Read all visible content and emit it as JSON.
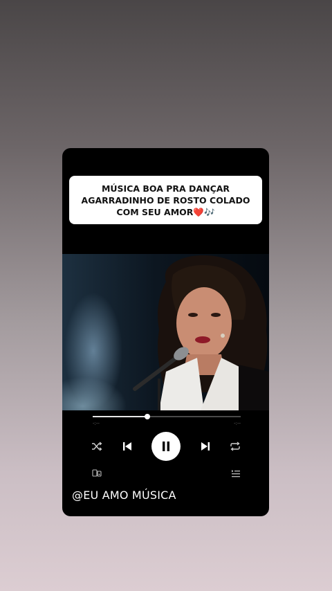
{
  "caption": {
    "lines": [
      "MÚSICA BOA PRA DANÇAR",
      "AGARRADINHO DE ROSTO COLADO",
      "COM SEU AMOR"
    ],
    "heart_emoji": "❤️",
    "notes_emoji": "🎶"
  },
  "player": {
    "progress_fraction": 0.37,
    "time_elapsed": "-:--",
    "time_remaining": "-:--",
    "state": "playing"
  },
  "icons": {
    "shuffle": "shuffle-icon",
    "previous": "skip-previous-icon",
    "play_pause": "pause-icon",
    "next": "skip-next-icon",
    "repeat": "repeat-icon",
    "devices": "connect-device-icon",
    "queue": "queue-icon"
  },
  "handle": "@EU AMO MÚSICA",
  "colors": {
    "card_background": "#000000",
    "caption_background": "#ffffff",
    "accent_white": "#ffffff",
    "track_inactive": "#4a4a4a"
  }
}
